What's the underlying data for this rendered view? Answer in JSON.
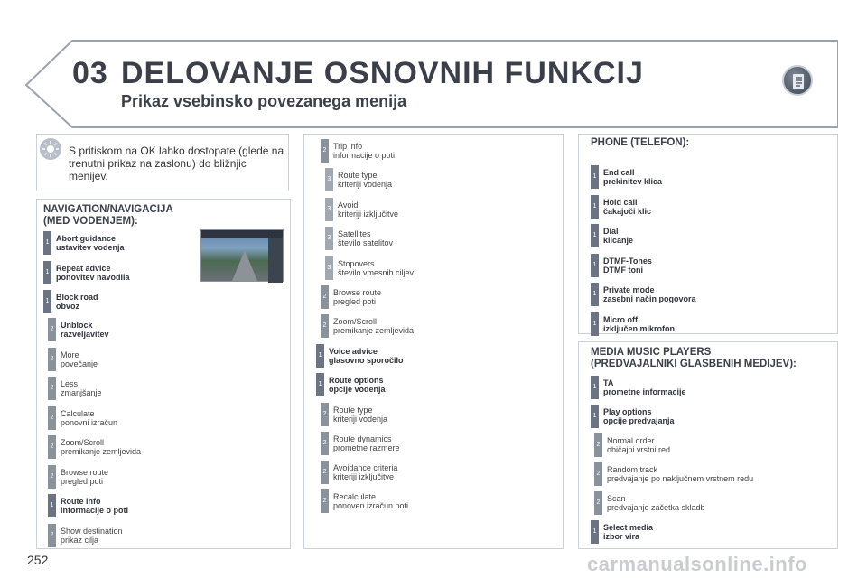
{
  "header": {
    "chapter": "03",
    "title": "DELOVANJE OSNOVNIH FUNKCIJ",
    "subtitle": "Prikaz vsebinsko povezanega menija"
  },
  "note": {
    "text": "S pritiskom na OK lahko dostopate (glede na trenutni prikaz na zaslonu) do bližnjic menijev."
  },
  "navigation": {
    "title_line1": "NAVIGATION/NAVIGACIJA",
    "title_line2": "(MED VODENJEM):",
    "items": [
      {
        "level": "1",
        "line1": "Abort guidance",
        "line2": "ustavitev vodenja",
        "bold": true
      },
      {
        "level": "1",
        "line1": "Repeat advice",
        "line2": "ponovitev navodila",
        "bold": true
      },
      {
        "level": "1",
        "line1": "Block road",
        "line2": "obvoz",
        "bold": true
      },
      {
        "level": "2",
        "line1": "Unblock",
        "line2": "razveljavitev",
        "bold": true
      },
      {
        "level": "2",
        "line1": "More",
        "line2": "povečanje",
        "bold": false
      },
      {
        "level": "2",
        "line1": "Less",
        "line2": "zmanjšanje",
        "bold": false
      },
      {
        "level": "2",
        "line1": "Calculate",
        "line2": "ponovni izračun",
        "bold": false
      },
      {
        "level": "2",
        "line1": "Zoom/Scroll",
        "line2": "premikanje zemljevida",
        "bold": false
      },
      {
        "level": "2",
        "line1": "Browse route",
        "line2": "pregled poti",
        "bold": false
      },
      {
        "level": "1",
        "line1": "Route info",
        "line2": "informacije o poti",
        "bold": true
      },
      {
        "level": "2",
        "line1": "Show destination",
        "line2": "prikaz cilja",
        "bold": false
      }
    ]
  },
  "middle": {
    "items": [
      {
        "level": "2",
        "line1": "Trip info",
        "line2": "informacije o poti",
        "bold": false
      },
      {
        "level": "3",
        "line1": "Route type",
        "line2": "kriteriji vodenja",
        "bold": false
      },
      {
        "level": "3",
        "line1": "Avoid",
        "line2": "kriteriji izključitve",
        "bold": false
      },
      {
        "level": "3",
        "line1": "Satellites",
        "line2": "število satelitov",
        "bold": false
      },
      {
        "level": "3",
        "line1": "Stopovers",
        "line2": "število vmesnih ciljev",
        "bold": false
      },
      {
        "level": "2",
        "line1": "Browse route",
        "line2": "pregled poti",
        "bold": false
      },
      {
        "level": "2",
        "line1": "Zoom/Scroll",
        "line2": "premikanje zemljevida",
        "bold": false
      },
      {
        "level": "1",
        "line1": "Voice advice",
        "line2": "glasovno sporočilo",
        "bold": true
      },
      {
        "level": "1",
        "line1": "Route options",
        "line2": "opcije vodenja",
        "bold": true
      },
      {
        "level": "2",
        "line1": "Route type",
        "line2": "kriteriji vodenja",
        "bold": false
      },
      {
        "level": "2",
        "line1": "Route dynamics",
        "line2": "prometne razmere",
        "bold": false
      },
      {
        "level": "2",
        "line1": "Avoidance criteria",
        "line2": "kriteriji izključitve",
        "bold": false
      },
      {
        "level": "2",
        "line1": "Recalculate",
        "line2": "ponoven izračun poti",
        "bold": false
      }
    ]
  },
  "phone": {
    "title": "PHONE (TELEFON):",
    "items": [
      {
        "level": "1",
        "line1": "End call",
        "line2": "prekinitev klica",
        "bold": true
      },
      {
        "level": "1",
        "line1": "Hold call",
        "line2": "čakajoči klic",
        "bold": true
      },
      {
        "level": "1",
        "line1": "Dial",
        "line2": "klicanje",
        "bold": true
      },
      {
        "level": "1",
        "line1": "DTMF-Tones",
        "line2": "DTMF toni",
        "bold": true
      },
      {
        "level": "1",
        "line1": "Private mode",
        "line2": "zasebni način pogovora",
        "bold": true
      },
      {
        "level": "1",
        "line1": "Micro off",
        "line2": "izključen mikrofon",
        "bold": true
      }
    ]
  },
  "media": {
    "title_line1": "MEDIA MUSIC PLAYERS",
    "title_line2": "(PREDVAJALNIKI GLASBENIH MEDIJEV):",
    "items": [
      {
        "level": "1",
        "line1": "TA",
        "line2": "prometne informacije",
        "bold": true
      },
      {
        "level": "1",
        "line1": "Play options",
        "line2": "opcije predvajanja",
        "bold": true
      },
      {
        "level": "2",
        "line1": "Normal order",
        "line2": "običajni vrstni red",
        "bold": false
      },
      {
        "level": "2",
        "line1": "Random track",
        "line2": "predvajanje po naključnem vrstnem redu",
        "bold": false
      },
      {
        "level": "2",
        "line1": "Scan",
        "line2": "predvajanje začetka skladb",
        "bold": false
      },
      {
        "level": "1",
        "line1": "Select media",
        "line2": "izbor vira",
        "bold": true
      }
    ]
  },
  "footer": {
    "page_number": "252",
    "watermark": "carmanualsonline.info"
  },
  "colors": {
    "level1": "#6b7480",
    "level2": "#8a929c",
    "level3": "#a1a8b1",
    "title_text": "#3a3f4a"
  }
}
